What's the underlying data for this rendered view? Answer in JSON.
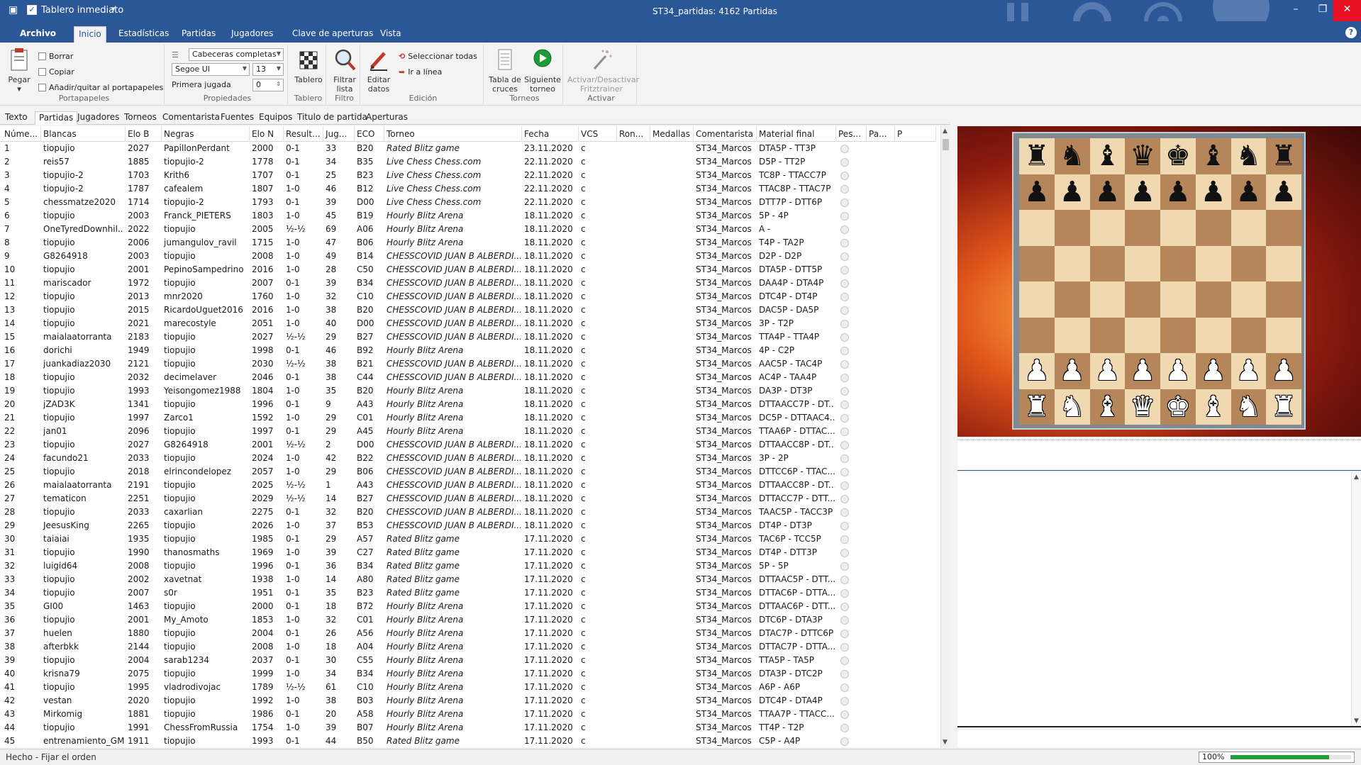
{
  "titlebar": {
    "quick_access_label": "Tablero inmediato",
    "quick_access_checked": true,
    "window_title": "ST34_partidas:  4162 Partidas",
    "icons": [
      "app-icon",
      "check-icon",
      "customize-quick-access-icon",
      "minimize-icon",
      "restore-icon",
      "close-icon"
    ]
  },
  "ribbon_tabs": [
    {
      "label": "Archivo"
    },
    {
      "label": "Inicio"
    },
    {
      "label": "Estadísticas"
    },
    {
      "label": "Partidas"
    },
    {
      "label": "Jugadores"
    },
    {
      "label": "Clave de aperturas"
    },
    {
      "label": "Vista"
    }
  ],
  "active_ribbon_tab": "Inicio",
  "ribbon": {
    "clipboard": {
      "label": "Portapapeles",
      "paste": "Pegar",
      "delete": "Borrar",
      "copy": "Copiar",
      "toggle_clipboard": "Añadir/quitar al portapapeles"
    },
    "properties": {
      "label": "Propiedades",
      "header_mode": "Cabeceras completas",
      "font": "Segoe UI",
      "font_size": "13",
      "first_move_label": "Primera jugada",
      "first_move_value": "0"
    },
    "board": {
      "label": "Tablero",
      "button": "Tablero"
    },
    "filter": {
      "label": "Filtro",
      "button_line1": "Filtrar",
      "button_line2": "lista"
    },
    "edit": {
      "label": "Edición",
      "edit_line1": "Editar",
      "edit_line2": "datos",
      "select_all": "Seleccionar todas",
      "goto_line": "Ir a línea"
    },
    "tournaments": {
      "label": "Torneos",
      "crosstable_line1": "Tabla de",
      "crosstable_line2": "cruces",
      "next_line1": "Siguiente",
      "next_line2": "torneo"
    },
    "activate": {
      "label": "Activar",
      "button_line1": "Activar/Desactivar",
      "button_line2": "Fritztrainer"
    }
  },
  "view_tabs": [
    "Texto",
    "Partidas",
    "Jugadores",
    "Torneos",
    "Comentarista",
    "Fuentes",
    "Equipos",
    "Titulo de partida",
    "Aperturas"
  ],
  "active_view_tab": "Partidas",
  "table": {
    "columns": [
      "Núme...",
      "Blancas",
      "Elo B",
      "Negras",
      "Elo N",
      "Result...",
      "Jug...",
      "ECO",
      "Torneo",
      "Fecha",
      "VCS",
      "Ron...",
      "Medallas",
      "Comentarista",
      "Material final",
      "Pes...",
      "Pa...",
      "P"
    ],
    "rows": [
      [
        "1",
        "tiopujio",
        "2027",
        "PapillonPerdant",
        "2000",
        "0-1",
        "33",
        "B20",
        "Rated Blitz game",
        "23.11.2020",
        "c",
        "",
        "",
        "ST34_Marcos",
        "DTA5P - TT3P"
      ],
      [
        "2",
        "reis57",
        "1885",
        "tiopujio-2",
        "1778",
        "0-1",
        "34",
        "B35",
        "Live Chess Chess.com",
        "22.11.2020",
        "c",
        "",
        "",
        "ST34_Marcos",
        "D5P - TT2P"
      ],
      [
        "3",
        "tiopujio-2",
        "1703",
        "Krith6",
        "1707",
        "0-1",
        "25",
        "B23",
        "Live Chess Chess.com",
        "22.11.2020",
        "c",
        "",
        "",
        "ST34_Marcos",
        "TC8P - TTACC7P"
      ],
      [
        "4",
        "tiopujio-2",
        "1787",
        "cafealem",
        "1807",
        "1-0",
        "46",
        "B12",
        "Live Chess Chess.com",
        "22.11.2020",
        "c",
        "",
        "",
        "ST34_Marcos",
        "TTAC8P - TTAC7P"
      ],
      [
        "5",
        "chessmatze2020",
        "1714",
        "tiopujio-2",
        "1793",
        "0-1",
        "39",
        "D00",
        "Live Chess Chess.com",
        "22.11.2020",
        "c",
        "",
        "",
        "ST34_Marcos",
        "DTT7P - DTT6P"
      ],
      [
        "6",
        "tiopujio",
        "2003",
        "Franck_PIETERS",
        "1803",
        "1-0",
        "45",
        "B19",
        "Hourly Blitz Arena",
        "18.11.2020",
        "c",
        "",
        "",
        "ST34_Marcos",
        "5P - 4P"
      ],
      [
        "7",
        "OneTyredDownhil...",
        "2022",
        "tiopujio",
        "2005",
        "½-½",
        "69",
        "A06",
        "Hourly Blitz Arena",
        "18.11.2020",
        "c",
        "",
        "",
        "ST34_Marcos",
        "A -"
      ],
      [
        "8",
        "tiopujio",
        "2006",
        "jumangulov_ravil",
        "1715",
        "1-0",
        "47",
        "B06",
        "Hourly Blitz Arena",
        "18.11.2020",
        "c",
        "",
        "",
        "ST34_Marcos",
        "T4P - TA2P"
      ],
      [
        "9",
        "G8264918",
        "2003",
        "tiopujio",
        "2008",
        "1-0",
        "49",
        "B14",
        "CHESSCOVID JUAN B ALBERDI...",
        "18.11.2020",
        "c",
        "",
        "",
        "ST34_Marcos",
        "D2P - D2P"
      ],
      [
        "10",
        "tiopujio",
        "2001",
        "PepinoSampedrino",
        "2016",
        "1-0",
        "28",
        "C50",
        "CHESSCOVID JUAN B ALBERDI...",
        "18.11.2020",
        "c",
        "",
        "",
        "ST34_Marcos",
        "DTA5P - DTT5P"
      ],
      [
        "11",
        "mariscador",
        "1972",
        "tiopujio",
        "2007",
        "0-1",
        "39",
        "B34",
        "CHESSCOVID JUAN B ALBERDI...",
        "18.11.2020",
        "c",
        "",
        "",
        "ST34_Marcos",
        "DAA4P - DTA4P"
      ],
      [
        "12",
        "tiopujio",
        "2013",
        "mnr2020",
        "1760",
        "1-0",
        "32",
        "C10",
        "CHESSCOVID JUAN B ALBERDI...",
        "18.11.2020",
        "c",
        "",
        "",
        "ST34_Marcos",
        "DTC4P - DT4P"
      ],
      [
        "13",
        "tiopujio",
        "2015",
        "RicardoUguet2016",
        "2016",
        "1-0",
        "38",
        "B20",
        "CHESSCOVID JUAN B ALBERDI...",
        "18.11.2020",
        "c",
        "",
        "",
        "ST34_Marcos",
        "DAC5P - DA5P"
      ],
      [
        "14",
        "tiopujio",
        "2021",
        "marecostyle",
        "2051",
        "1-0",
        "40",
        "D00",
        "CHESSCOVID JUAN B ALBERDI...",
        "18.11.2020",
        "c",
        "",
        "",
        "ST34_Marcos",
        "3P - T2P"
      ],
      [
        "15",
        "maialaatorranta",
        "2183",
        "tiopujio",
        "2027",
        "½-½",
        "29",
        "B27",
        "CHESSCOVID JUAN B ALBERDI...",
        "18.11.2020",
        "c",
        "",
        "",
        "ST34_Marcos",
        "TTA4P - TTA4P"
      ],
      [
        "16",
        "dorichi",
        "1949",
        "tiopujio",
        "1998",
        "0-1",
        "46",
        "B92",
        "Hourly Blitz Arena",
        "18.11.2020",
        "c",
        "",
        "",
        "ST34_Marcos",
        "4P - C2P"
      ],
      [
        "17",
        "juankadiaz2030",
        "2121",
        "tiopujio",
        "2030",
        "½-½",
        "38",
        "B21",
        "CHESSCOVID JUAN B ALBERDI...",
        "18.11.2020",
        "c",
        "",
        "",
        "ST34_Marcos",
        "AAC5P - TAC4P"
      ],
      [
        "18",
        "tiopujio",
        "2032",
        "decimelaver",
        "2046",
        "0-1",
        "38",
        "C44",
        "CHESSCOVID JUAN B ALBERDI...",
        "18.11.2020",
        "c",
        "",
        "",
        "ST34_Marcos",
        "AC4P - TAA4P"
      ],
      [
        "19",
        "tiopujio",
        "1993",
        "Yeisongomez1988",
        "1804",
        "1-0",
        "35",
        "B20",
        "Hourly Blitz Arena",
        "18.11.2020",
        "c",
        "",
        "",
        "ST34_Marcos",
        "DA3P - DT3P"
      ],
      [
        "20",
        "jZAD3K",
        "1341",
        "tiopujio",
        "1996",
        "0-1",
        "9",
        "A43",
        "Hourly Blitz Arena",
        "18.11.2020",
        "c",
        "",
        "",
        "ST34_Marcos",
        "DTTAACC7P - DT..."
      ],
      [
        "21",
        "tiopujio",
        "1997",
        "Zarco1",
        "1592",
        "1-0",
        "29",
        "C01",
        "Hourly Blitz Arena",
        "18.11.2020",
        "c",
        "",
        "",
        "ST34_Marcos",
        "DC5P - DTTAAC4..."
      ],
      [
        "22",
        "jan01",
        "2096",
        "tiopujio",
        "1997",
        "0-1",
        "29",
        "A45",
        "Hourly Blitz Arena",
        "18.11.2020",
        "c",
        "",
        "",
        "ST34_Marcos",
        "TTAA6P - DTTAC..."
      ],
      [
        "23",
        "tiopujio",
        "2027",
        "G8264918",
        "2001",
        "½-½",
        "2",
        "D00",
        "CHESSCOVID JUAN B ALBERDI...",
        "18.11.2020",
        "c",
        "",
        "",
        "ST34_Marcos",
        "DTTAACC8P - DT..."
      ],
      [
        "24",
        "facundo21",
        "2033",
        "tiopujio",
        "2024",
        "1-0",
        "42",
        "B22",
        "CHESSCOVID JUAN B ALBERDI...",
        "18.11.2020",
        "c",
        "",
        "",
        "ST34_Marcos",
        "3P - 2P"
      ],
      [
        "25",
        "tiopujio",
        "2018",
        "elrincondelopez",
        "2057",
        "1-0",
        "29",
        "B06",
        "CHESSCOVID JUAN B ALBERDI...",
        "18.11.2020",
        "c",
        "",
        "",
        "ST34_Marcos",
        "DTTCC6P - TTAC..."
      ],
      [
        "26",
        "maialaatorranta",
        "2191",
        "tiopujio",
        "2025",
        "½-½",
        "1",
        "A43",
        "CHESSCOVID JUAN B ALBERDI...",
        "18.11.2020",
        "c",
        "",
        "",
        "ST34_Marcos",
        "DTTAACC8P - DT..."
      ],
      [
        "27",
        "tematicon",
        "2251",
        "tiopujio",
        "2029",
        "½-½",
        "14",
        "B27",
        "CHESSCOVID JUAN B ALBERDI...",
        "18.11.2020",
        "c",
        "",
        "",
        "ST34_Marcos",
        "DTTACC7P - DTT..."
      ],
      [
        "28",
        "tiopujio",
        "2033",
        "caxarlian",
        "2275",
        "0-1",
        "32",
        "B20",
        "CHESSCOVID JUAN B ALBERDI...",
        "18.11.2020",
        "c",
        "",
        "",
        "ST34_Marcos",
        "TAAC5P - TACC3P"
      ],
      [
        "29",
        "JeesusKing",
        "2265",
        "tiopujio",
        "2026",
        "1-0",
        "37",
        "B53",
        "CHESSCOVID JUAN B ALBERDI...",
        "18.11.2020",
        "c",
        "",
        "",
        "ST34_Marcos",
        "DT4P - DT3P"
      ],
      [
        "30",
        "taiaiai",
        "1935",
        "tiopujio",
        "1985",
        "0-1",
        "29",
        "A57",
        "Rated Blitz game",
        "17.11.2020",
        "c",
        "",
        "",
        "ST34_Marcos",
        "TAC6P - TCC5P"
      ],
      [
        "31",
        "tiopujio",
        "1990",
        "thanosmaths",
        "1969",
        "1-0",
        "39",
        "C27",
        "Rated Blitz game",
        "17.11.2020",
        "c",
        "",
        "",
        "ST34_Marcos",
        "DT4P - DTT3P"
      ],
      [
        "32",
        "luigid64",
        "2008",
        "tiopujio",
        "1996",
        "0-1",
        "36",
        "B34",
        "Rated Blitz game",
        "17.11.2020",
        "c",
        "",
        "",
        "ST34_Marcos",
        "5P - 5P"
      ],
      [
        "33",
        "tiopujio",
        "2002",
        "xavetnat",
        "1938",
        "1-0",
        "14",
        "A80",
        "Rated Blitz game",
        "17.11.2020",
        "c",
        "",
        "",
        "ST34_Marcos",
        "DTTAAC5P - DTT..."
      ],
      [
        "34",
        "tiopujio",
        "2007",
        "s0r",
        "1951",
        "0-1",
        "35",
        "B23",
        "Rated Blitz game",
        "17.11.2020",
        "c",
        "",
        "",
        "ST34_Marcos",
        "DTTAC6P - DTTA..."
      ],
      [
        "35",
        "GI00",
        "1463",
        "tiopujio",
        "2000",
        "0-1",
        "18",
        "B72",
        "Hourly Blitz Arena",
        "17.11.2020",
        "c",
        "",
        "",
        "ST34_Marcos",
        "DTTAAC6P - DTT..."
      ],
      [
        "36",
        "tiopujio",
        "2001",
        "My_Amoto",
        "1853",
        "1-0",
        "32",
        "C01",
        "Hourly Blitz Arena",
        "17.11.2020",
        "c",
        "",
        "",
        "ST34_Marcos",
        "DTC6P - DTA3P"
      ],
      [
        "37",
        "huelen",
        "1880",
        "tiopujio",
        "2004",
        "0-1",
        "26",
        "A56",
        "Hourly Blitz Arena",
        "17.11.2020",
        "c",
        "",
        "",
        "ST34_Marcos",
        "DTAC7P - DTTC6P"
      ],
      [
        "38",
        "afterbkk",
        "2144",
        "tiopujio",
        "2008",
        "1-0",
        "18",
        "A04",
        "Hourly Blitz Arena",
        "17.11.2020",
        "c",
        "",
        "",
        "ST34_Marcos",
        "DTTAC7P - DTTA..."
      ],
      [
        "39",
        "tiopujio",
        "2004",
        "sarab1234",
        "2037",
        "0-1",
        "30",
        "C55",
        "Hourly Blitz Arena",
        "17.11.2020",
        "c",
        "",
        "",
        "ST34_Marcos",
        "TTA5P - TA5P"
      ],
      [
        "40",
        "krisna79",
        "2075",
        "tiopujio",
        "1999",
        "1-0",
        "34",
        "B34",
        "Hourly Blitz Arena",
        "17.11.2020",
        "c",
        "",
        "",
        "ST34_Marcos",
        "DTA3P - DTC2P"
      ],
      [
        "41",
        "tiopujio",
        "1995",
        "vladrodivojac",
        "1789",
        "½-½",
        "61",
        "C10",
        "Hourly Blitz Arena",
        "17.11.2020",
        "c",
        "",
        "",
        "ST34_Marcos",
        "A6P - A6P"
      ],
      [
        "42",
        "vestan",
        "2020",
        "tiopujio",
        "1992",
        "1-0",
        "38",
        "B03",
        "Hourly Blitz Arena",
        "17.11.2020",
        "c",
        "",
        "",
        "ST34_Marcos",
        "DTC4P - DTA4P"
      ],
      [
        "43",
        "Mirkomig",
        "1881",
        "tiopujio",
        "1986",
        "0-1",
        "20",
        "A58",
        "Hourly Blitz Arena",
        "17.11.2020",
        "c",
        "",
        "",
        "ST34_Marcos",
        "TTAA7P - TTACC..."
      ],
      [
        "44",
        "tiopujio",
        "1991",
        "ChessFromRussia",
        "1754",
        "1-0",
        "39",
        "B07",
        "Hourly Blitz Arena",
        "17.11.2020",
        "c",
        "",
        "",
        "ST34_Marcos",
        "TT4P - T2P"
      ],
      [
        "45",
        "entrenamiento_GM...",
        "1911",
        "tiopujio",
        "1993",
        "0-1",
        "44",
        "B50",
        "Rated Blitz game",
        "17.11.2020",
        "c",
        "",
        "",
        "ST34_Marcos",
        "C5P - A4P"
      ]
    ]
  },
  "board": {
    "ranks": [
      [
        "r",
        "n",
        "b",
        "q",
        "k",
        "b",
        "n",
        "r"
      ],
      [
        "p",
        "p",
        "p",
        "p",
        "p",
        "p",
        "p",
        "p"
      ],
      [
        "",
        "",
        "",
        "",
        "",
        "",
        "",
        ""
      ],
      [
        "",
        "",
        "",
        "",
        "",
        "",
        "",
        ""
      ],
      [
        "",
        "",
        "",
        "",
        "",
        "",
        "",
        ""
      ],
      [
        "",
        "",
        "",
        "",
        "",
        "",
        "",
        ""
      ],
      [
        "P",
        "P",
        "P",
        "P",
        "P",
        "P",
        "P",
        "P"
      ],
      [
        "R",
        "N",
        "B",
        "Q",
        "K",
        "B",
        "N",
        "R"
      ]
    ]
  },
  "status": {
    "text": "Hecho - Fijar el orden",
    "zoom_label": "100%",
    "progress_fraction": 0.82
  },
  "colors": {
    "ribbon_blue": "#2b5797",
    "board_light": "#f0d9b0",
    "board_dark": "#b5865a",
    "progress_green": "#1fa034"
  }
}
